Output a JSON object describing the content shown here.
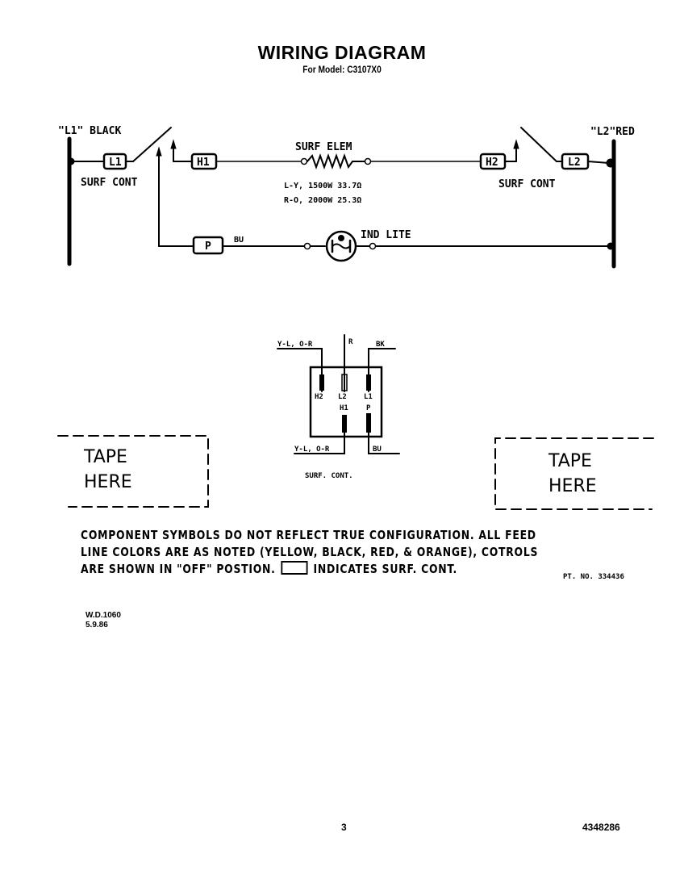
{
  "header": {
    "title": "WIRING DIAGRAM",
    "subtitle": "For Model: C3107X0"
  },
  "schematic": {
    "l1_label": "\"L1\" BLACK",
    "l2_label": "\"L2\"RED",
    "left_switch": {
      "terminal": "L1",
      "label": "SURF CONT"
    },
    "right_switch": {
      "terminal": "L2",
      "label": "SURF CONT"
    },
    "h1_terminal": "H1",
    "h2_terminal": "H2",
    "p_terminal": "P",
    "element": {
      "label": "SURF ELEM",
      "rating_1": "L-Y, 1500W  33.7Ω",
      "rating_2": "R-O, 2000W  25.3Ω"
    },
    "bu_wire": "BU",
    "indicator_label": "IND LITE"
  },
  "switch_detail": {
    "top_left_wire": "Y-L, O-R",
    "top_center_wire": "R",
    "top_right_wire": "BK",
    "bottom_left_wire": "Y-L, O-R",
    "bottom_right_wire": "BU",
    "terminals": [
      "H2",
      "L2",
      "L1",
      "H1",
      "P"
    ],
    "caption": "SURF. CONT."
  },
  "tape_boxes": [
    {
      "line1": "TAPE",
      "line2": "HERE"
    },
    {
      "line1": "TAPE",
      "line2": "HERE"
    }
  ],
  "notes": {
    "line1": "COMPONENT SYMBOLS DO NOT REFLECT TRUE CONFIGURATION. ALL FEED",
    "line2": "LINE COLORS ARE AS NOTED (YELLOW, BLACK, RED, & ORANGE), COTROLS",
    "line3_a": "ARE SHOWN IN \"OFF\" POSTION.",
    "line3_b": "INDICATES SURF. CONT.",
    "part_number": "PT. NO. 334436"
  },
  "footer": {
    "wd_number": "W.D.1060",
    "wd_date": "5.9.86",
    "page_number": "3",
    "doc_number": "4348286"
  }
}
